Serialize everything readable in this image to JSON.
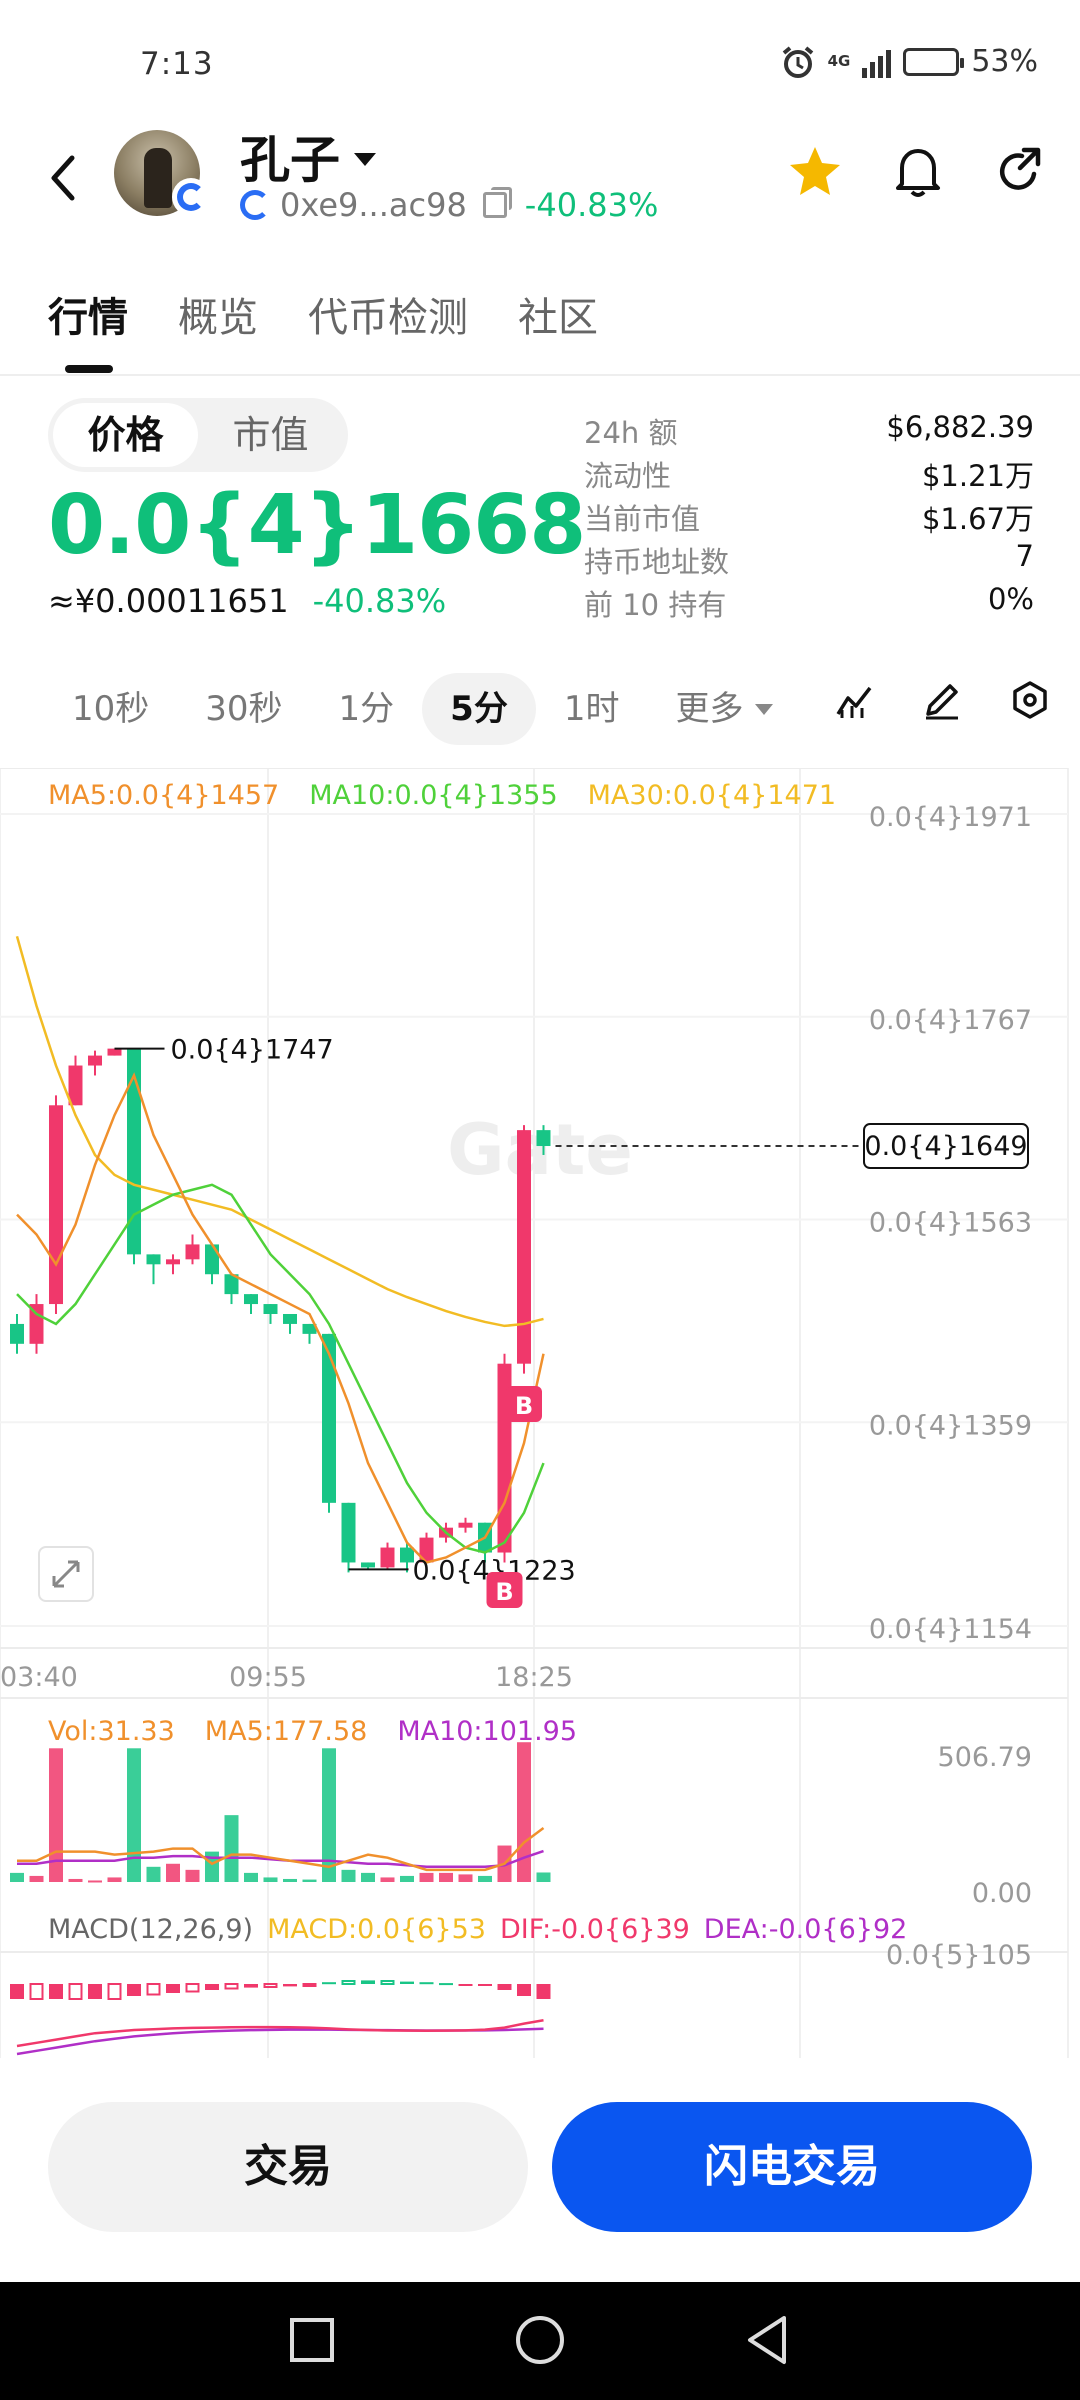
{
  "status_bar": {
    "time": "7:13",
    "network": "4G",
    "battery": "53%",
    "battery_level": 0.53
  },
  "header": {
    "token_name": "孔子",
    "address": "0xe9...ac98",
    "change": "-40.83%",
    "icons": [
      "back-icon",
      "star-icon",
      "bell-icon",
      "share-icon"
    ],
    "star_color": "#f5b800"
  },
  "tabs": [
    {
      "label": "行情",
      "active": true
    },
    {
      "label": "概览",
      "active": false
    },
    {
      "label": "代币检测",
      "active": false
    },
    {
      "label": "社区",
      "active": false
    }
  ],
  "price_toggle": {
    "price_label": "价格",
    "mcap_label": "市值",
    "selected": "价格"
  },
  "price": {
    "main": "0.0{4}1668",
    "cny": "≈¥0.00011651",
    "change": "-40.83%"
  },
  "stats": [
    {
      "key": "24h  额",
      "value": "$6,882.39"
    },
    {
      "key": "流动性",
      "value": "$1.21万"
    },
    {
      "key": "当前市值",
      "value": "$1.67万"
    },
    {
      "key": "持币地址数",
      "value": "7"
    },
    {
      "key": "前 10 持有",
      "value": "0%"
    }
  ],
  "intervals": [
    {
      "label": "10秒",
      "active": false
    },
    {
      "label": "30秒",
      "active": false
    },
    {
      "label": "1分",
      "active": false
    },
    {
      "label": "5分",
      "active": true
    },
    {
      "label": "1时",
      "active": false
    }
  ],
  "more_label": "更多",
  "chart_tools": [
    "indicator-icon",
    "draw-icon",
    "settings-icon"
  ],
  "colors": {
    "up": "#f0386b",
    "down": "#18c586",
    "accent": "#0a56f0",
    "price_green": "#0fbf7a"
  },
  "ma_legend": {
    "ma5": "MA5:0.0{4}1457",
    "ma10": "MA10:0.0{4}1355",
    "ma30": "MA30:0.0{4}1471"
  },
  "vol_legend": {
    "vol": "Vol:31.33",
    "ma5": "MA5:177.58",
    "ma10": "MA10:101.95"
  },
  "macd_legend": {
    "macd": "MACD(12,26,9)",
    "value": "MACD:0.0{6}53",
    "dif": "DIF:-0.0{6}39",
    "dea": "DEA:-0.0{6}92"
  },
  "chart_data": {
    "type": "candlestick",
    "price_axis_labels": [
      "0.0{4}1971",
      "0.0{4}1767",
      "0.0{4}1563",
      "0.0{4}1359",
      "0.0{4}1154"
    ],
    "price_axis_values": [
      1.971e-05,
      1.767e-05,
      1.563e-05,
      1.359e-05,
      1.154e-05
    ],
    "ylim": [
      1.14e-05,
      2e-05
    ],
    "time_labels": [
      "03:40",
      "09:55",
      "18:25"
    ],
    "high_marker": "0.0{4}1747",
    "low_marker": "0.0{4}1223",
    "last_price_tag": "0.0{4}1649",
    "trade_markers": [
      "B",
      "B"
    ],
    "candles": [
      {
        "o": 1.47,
        "c": 1.45,
        "h": 1.48,
        "l": 1.44
      },
      {
        "o": 1.45,
        "c": 1.49,
        "h": 1.5,
        "l": 1.44
      },
      {
        "o": 1.49,
        "c": 1.69,
        "h": 1.7,
        "l": 1.48
      },
      {
        "o": 1.69,
        "c": 1.73,
        "h": 1.74,
        "l": 1.69
      },
      {
        "o": 1.73,
        "c": 1.74,
        "h": 1.745,
        "l": 1.72
      },
      {
        "o": 1.74,
        "c": 1.747,
        "h": 1.747,
        "l": 1.74
      },
      {
        "o": 1.747,
        "c": 1.54,
        "h": 1.747,
        "l": 1.53
      },
      {
        "o": 1.54,
        "c": 1.53,
        "h": 1.54,
        "l": 1.51
      },
      {
        "o": 1.53,
        "c": 1.535,
        "h": 1.54,
        "l": 1.52
      },
      {
        "o": 1.535,
        "c": 1.55,
        "h": 1.56,
        "l": 1.53
      },
      {
        "o": 1.55,
        "c": 1.52,
        "h": 1.55,
        "l": 1.51
      },
      {
        "o": 1.52,
        "c": 1.5,
        "h": 1.52,
        "l": 1.49
      },
      {
        "o": 1.5,
        "c": 1.49,
        "h": 1.5,
        "l": 1.48
      },
      {
        "o": 1.49,
        "c": 1.48,
        "h": 1.49,
        "l": 1.47
      },
      {
        "o": 1.48,
        "c": 1.47,
        "h": 1.48,
        "l": 1.46
      },
      {
        "o": 1.47,
        "c": 1.46,
        "h": 1.47,
        "l": 1.45
      },
      {
        "o": 1.46,
        "c": 1.29,
        "h": 1.46,
        "l": 1.28
      },
      {
        "o": 1.29,
        "c": 1.23,
        "h": 1.29,
        "l": 1.22
      },
      {
        "o": 1.23,
        "c": 1.225,
        "h": 1.23,
        "l": 1.223
      },
      {
        "o": 1.225,
        "c": 1.245,
        "h": 1.25,
        "l": 1.223
      },
      {
        "o": 1.245,
        "c": 1.23,
        "h": 1.25,
        "l": 1.22
      },
      {
        "o": 1.23,
        "c": 1.255,
        "h": 1.26,
        "l": 1.23
      },
      {
        "o": 1.255,
        "c": 1.265,
        "h": 1.27,
        "l": 1.25
      },
      {
        "o": 1.265,
        "c": 1.27,
        "h": 1.275,
        "l": 1.26
      },
      {
        "o": 1.27,
        "c": 1.24,
        "h": 1.27,
        "l": 1.23
      },
      {
        "o": 1.24,
        "c": 1.43,
        "h": 1.44,
        "l": 1.23
      },
      {
        "o": 1.43,
        "c": 1.665,
        "h": 1.67,
        "l": 1.42
      },
      {
        "o": 1.665,
        "c": 1.649,
        "h": 1.67,
        "l": 1.64
      }
    ],
    "price_units": "×10⁻⁵",
    "ma5": [
      1.58,
      1.56,
      1.53,
      1.57,
      1.63,
      1.68,
      1.72,
      1.66,
      1.62,
      1.58,
      1.55,
      1.52,
      1.51,
      1.5,
      1.49,
      1.48,
      1.44,
      1.39,
      1.33,
      1.29,
      1.25,
      1.23,
      1.235,
      1.245,
      1.255,
      1.29,
      1.35,
      1.44
    ],
    "ma10": [
      1.5,
      1.48,
      1.47,
      1.49,
      1.52,
      1.55,
      1.58,
      1.59,
      1.6,
      1.605,
      1.61,
      1.6,
      1.57,
      1.54,
      1.52,
      1.5,
      1.47,
      1.43,
      1.39,
      1.35,
      1.31,
      1.28,
      1.26,
      1.245,
      1.24,
      1.25,
      1.28,
      1.33
    ],
    "ma30": [
      1.86,
      1.79,
      1.73,
      1.68,
      1.64,
      1.62,
      1.61,
      1.605,
      1.6,
      1.595,
      1.59,
      1.585,
      1.575,
      1.565,
      1.555,
      1.545,
      1.535,
      1.525,
      1.515,
      1.505,
      1.497,
      1.49,
      1.483,
      1.477,
      1.472,
      1.468,
      1.47,
      1.475
    ],
    "volume_axis_labels": [
      "506.79",
      "0.00"
    ],
    "volumes": [
      30,
      20,
      440,
      10,
      5,
      15,
      440,
      50,
      60,
      40,
      100,
      220,
      30,
      15,
      10,
      8,
      440,
      40,
      30,
      15,
      20,
      30,
      30,
      25,
      20,
      120,
      460,
      31.33
    ],
    "vol_ma5": [
      70,
      70,
      100,
      100,
      100,
      90,
      95,
      100,
      110,
      110,
      60,
      90,
      90,
      80,
      70,
      60,
      50,
      70,
      90,
      80,
      60,
      40,
      40,
      40,
      40,
      60,
      130,
      177.58
    ],
    "vol_ma10": [
      60,
      60,
      70,
      70,
      70,
      70,
      80,
      80,
      85,
      85,
      80,
      80,
      80,
      75,
      70,
      70,
      70,
      65,
      60,
      60,
      55,
      50,
      50,
      50,
      50,
      55,
      80,
      101.95
    ],
    "macd_axis_label": "0.0{5}105",
    "macd_hist": [
      -5,
      -5,
      -5,
      -5,
      -5,
      -5,
      -4,
      -3.5,
      -3,
      -2.5,
      -2,
      -1.5,
      -1.2,
      -1,
      -0.8,
      -0.4,
      0.6,
      1.0,
      1.2,
      1.0,
      0.8,
      0.6,
      0.3,
      -0.1,
      -0.5,
      -2,
      -4,
      -5
    ],
    "macd_dif": [
      -20,
      -18,
      -16,
      -14,
      -12,
      -11,
      -10,
      -9.5,
      -9,
      -8.7,
      -8.5,
      -8.3,
      -8.2,
      -8.2,
      -8.3,
      -8.5,
      -9,
      -9.6,
      -10,
      -10.3,
      -10.4,
      -10.5,
      -10.4,
      -10.2,
      -9.8,
      -8.5,
      -6,
      -3.9
    ],
    "macd_dea": [
      -25,
      -23,
      -21,
      -19,
      -17,
      -15.5,
      -14,
      -13,
      -12,
      -11.3,
      -10.8,
      -10.4,
      -10.1,
      -9.9,
      -9.8,
      -9.8,
      -9.8,
      -9.9,
      -10,
      -10.1,
      -10.2,
      -10.3,
      -10.3,
      -10.3,
      -10.2,
      -10,
      -9.6,
      -9.2
    ]
  },
  "buttons": {
    "trade": "交易",
    "flash_trade": "闪电交易"
  }
}
